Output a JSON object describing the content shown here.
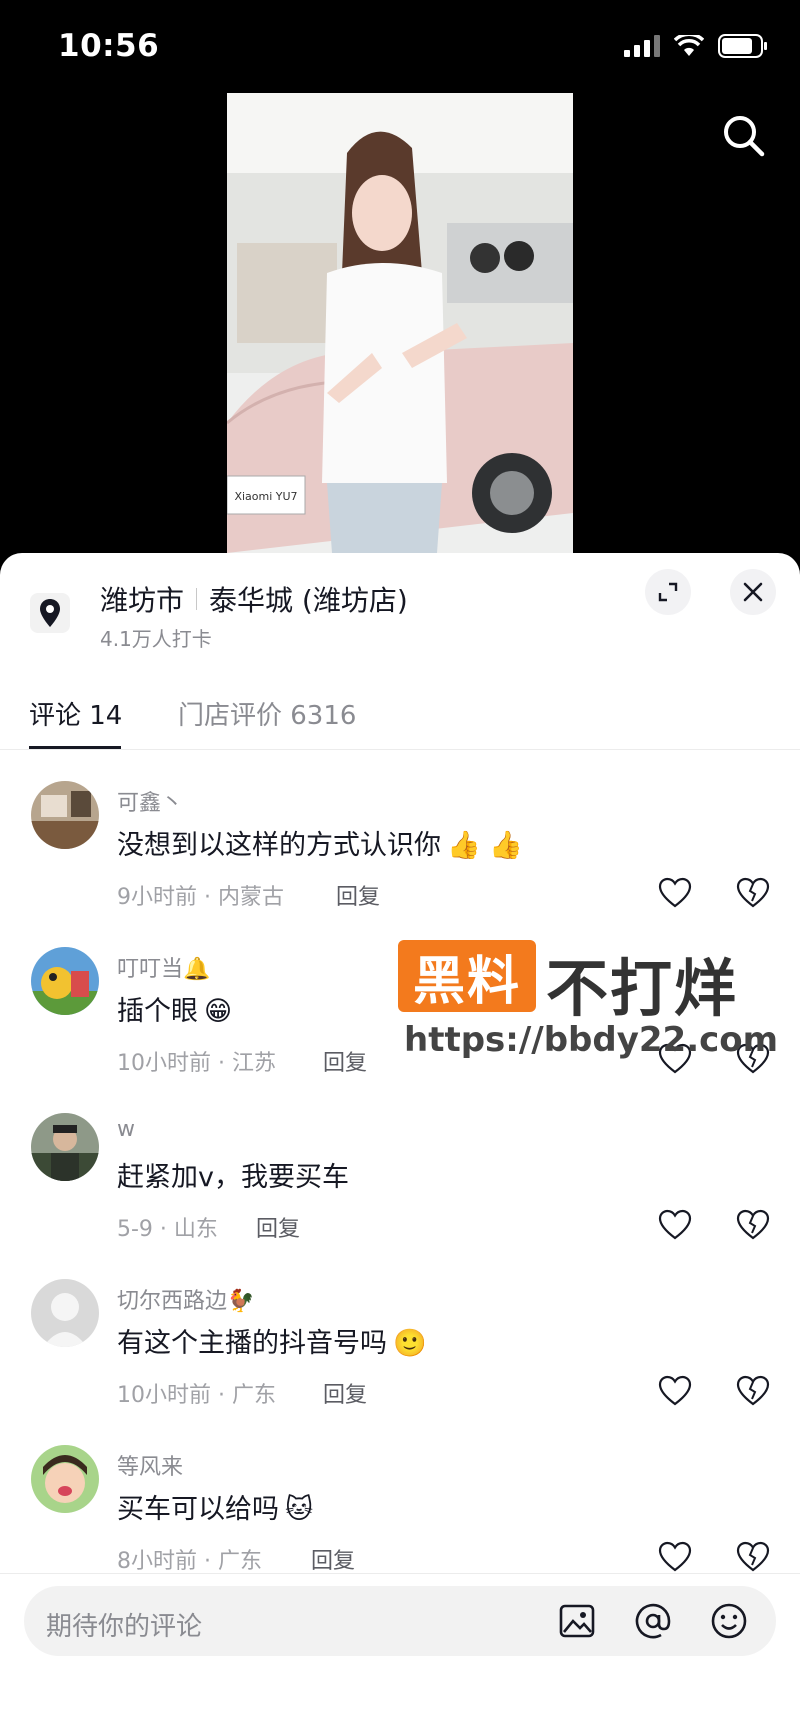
{
  "status": {
    "time": "10:56"
  },
  "location": {
    "city": "潍坊市",
    "store": "泰华城 (潍坊店)",
    "checkins": "4.1万人打卡"
  },
  "tabs": [
    {
      "label": "评论 14",
      "active": true
    },
    {
      "label": "门店评价 6316",
      "active": false
    }
  ],
  "comments": [
    {
      "user": "可鑫丶",
      "text": "没想到以这样的方式认识你",
      "emoji": "👍 👍",
      "meta": "9小时前 · 内蒙古",
      "reply": "回复"
    },
    {
      "user": "叮叮当",
      "user_emoji": "🔔",
      "text": "插个眼",
      "emoji": "😁",
      "meta": "10小时前 · 江苏",
      "reply": "回复"
    },
    {
      "user": "w",
      "text": "赶紧加v，我要买车",
      "emoji": "",
      "meta": "5-9 · 山东",
      "reply": "回复"
    },
    {
      "user": "切尔西路边",
      "user_emoji": "🐓",
      "text": "有这个主播的抖音号吗",
      "emoji": "🙂",
      "meta": "10小时前 · 广东",
      "reply": "回复"
    },
    {
      "user": "等风来",
      "text": "买车可以给吗",
      "emoji": "🐱",
      "meta": "8小时前 · 广东",
      "reply": "回复"
    }
  ],
  "watermark": {
    "badge": "黑料",
    "title": "不打烊",
    "url": "https://bbdy22.com"
  },
  "video": {
    "car_plate": "Xiaomi YU7"
  },
  "input": {
    "placeholder": "期待你的评论"
  },
  "colors": {
    "text": "#161823",
    "muted": "#8a8b91",
    "watermark_accent": "#f37a1d"
  }
}
